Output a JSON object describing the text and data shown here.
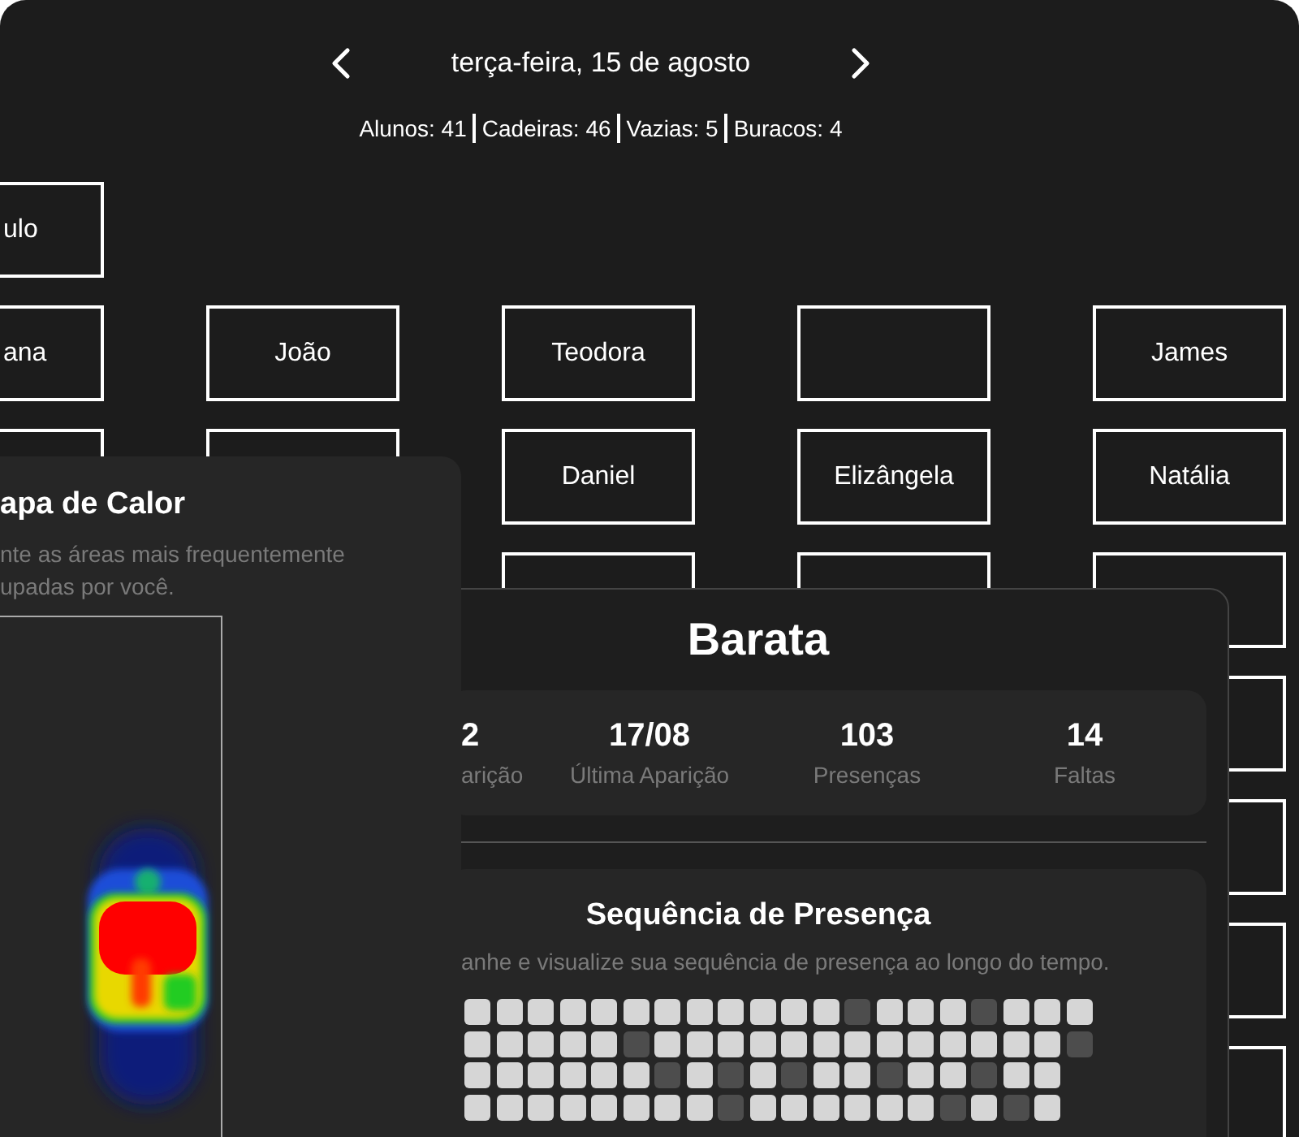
{
  "header": {
    "date": "terça-feira, 15 de agosto",
    "counts": [
      "Alunos: 41",
      "Cadeiras: 46",
      "Vazias: 5",
      "Buracos: 4"
    ]
  },
  "seat_rows": [
    {
      "seats": [
        {
          "kind": "named",
          "name": "ulo"
        },
        {
          "kind": "gap"
        },
        {
          "kind": "gap"
        },
        {
          "kind": "gap"
        },
        {
          "kind": "gap"
        }
      ]
    },
    {
      "seats": [
        {
          "kind": "named",
          "name": "ana"
        },
        {
          "kind": "named",
          "name": "João"
        },
        {
          "kind": "named",
          "name": "Teodora"
        },
        {
          "kind": "empty"
        },
        {
          "kind": "named",
          "name": "James"
        }
      ]
    },
    {
      "seats": [
        {
          "kind": "empty"
        },
        {
          "kind": "empty"
        },
        {
          "kind": "named",
          "name": "Daniel"
        },
        {
          "kind": "named",
          "name": "Elizângela"
        },
        {
          "kind": "named",
          "name": "Natália"
        }
      ]
    },
    {
      "seats": [
        {
          "kind": "gap"
        },
        {
          "kind": "gap"
        },
        {
          "kind": "empty"
        },
        {
          "kind": "empty"
        },
        {
          "kind": "empty"
        }
      ]
    },
    {
      "seats": [
        {
          "kind": "gap"
        },
        {
          "kind": "gap"
        },
        {
          "kind": "gap"
        },
        {
          "kind": "gap"
        },
        {
          "kind": "empty"
        }
      ]
    },
    {
      "seats": [
        {
          "kind": "gap"
        },
        {
          "kind": "gap"
        },
        {
          "kind": "gap"
        },
        {
          "kind": "gap"
        },
        {
          "kind": "empty"
        }
      ]
    },
    {
      "seats": [
        {
          "kind": "gap"
        },
        {
          "kind": "gap"
        },
        {
          "kind": "gap"
        },
        {
          "kind": "gap"
        },
        {
          "kind": "empty"
        }
      ]
    },
    {
      "seats": [
        {
          "kind": "gap"
        },
        {
          "kind": "gap"
        },
        {
          "kind": "gap"
        },
        {
          "kind": "gap"
        },
        {
          "kind": "empty"
        }
      ]
    }
  ],
  "heatmap_panel": {
    "title": "apa de Calor",
    "description": "nte as áreas mais frequentemente upadas por você."
  },
  "student_panel": {
    "name": "Barata",
    "stats": [
      {
        "value": "2",
        "label": "arição"
      },
      {
        "value": "17/08",
        "label": "Última Aparição"
      },
      {
        "value": "103",
        "label": "Presenças"
      },
      {
        "value": "14",
        "label": "Faltas"
      }
    ],
    "streak": {
      "title": "Sequência de Presença",
      "subtitle": "anhe e visualize sua sequência de presença ao longo do tempo.",
      "weeks": [
        [
          true,
          true,
          true,
          true,
          true,
          true,
          true,
          true,
          true,
          true,
          true,
          true,
          false,
          true,
          true,
          true,
          false,
          true,
          true,
          true
        ],
        [
          true,
          true,
          true,
          true,
          true,
          false,
          true,
          true,
          true,
          true,
          true,
          true,
          true,
          true,
          true,
          true,
          true,
          true,
          true,
          false
        ],
        [
          true,
          true,
          true,
          true,
          true,
          true,
          false,
          true,
          false,
          true,
          false,
          true,
          true,
          false,
          true,
          true,
          false,
          true,
          true
        ],
        [
          true,
          true,
          true,
          true,
          true,
          true,
          true,
          true,
          false,
          true,
          true,
          true,
          true,
          true,
          true,
          false,
          true,
          false,
          true
        ]
      ]
    }
  }
}
